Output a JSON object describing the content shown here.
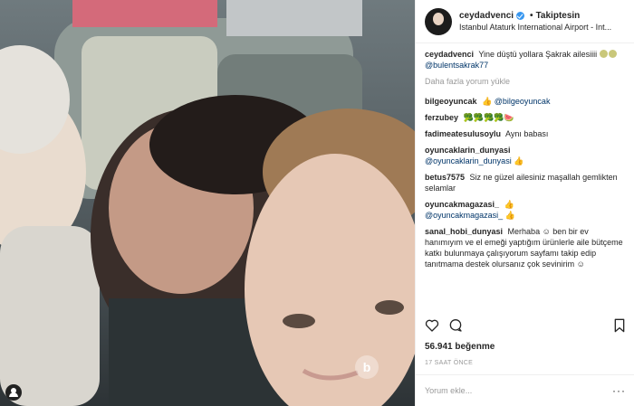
{
  "post": {
    "username": "ceydadvenci",
    "follow_label": "Takiptesin",
    "location": "Istanbul Ataturk International Airport - Int...",
    "caption_user": "ceydadvenci",
    "caption_text": "Yine düştü yollara Şakrak ailesiiii",
    "caption_mention": "@bulentsakrak77",
    "load_more": "Daha fazla yorum yükle"
  },
  "comments": [
    {
      "user": "bilgeoyuncak",
      "text": "👍",
      "mention": "@bilgeoyuncak"
    },
    {
      "user": "ferzubey",
      "text": "🥦🥦🥦🥦🍉",
      "mention": ""
    },
    {
      "user": "fadimeatesulusoylu",
      "text": "Aynı babası",
      "mention": ""
    },
    {
      "user": "oyuncaklarin_dunyasi",
      "text": "",
      "mention": "@oyuncaklarin_dunyasi 👍"
    },
    {
      "user": "betus7575",
      "text": "Siz ne güzel ailesiniz maşallah gemlikten selamlar",
      "mention": ""
    },
    {
      "user": "oyuncakmagazasi_",
      "text": "👍",
      "mention": "@oyuncakmagazasi_ 👍"
    },
    {
      "user": "sanal_hobi_dunyasi",
      "text": "Merhaba ☺ ben bir ev hanımıyım ve el emeği yaptığım ürünlerle aile bütçeme katkı bulunmaya çalışıyorum sayfamı takip edip tanıtmama destek olursanız çok sevinirim ☺",
      "mention": ""
    }
  ],
  "likes": "56.941 beğenme",
  "time": "17 SAAT ÖNCE",
  "add_comment_placeholder": "Yorum ekle...",
  "more_label": "···",
  "icons": {
    "heart": "heart-icon",
    "comment": "comment-icon",
    "bookmark": "bookmark-icon",
    "user_tag": "user-tag-icon",
    "verified": "verified-badge-icon"
  },
  "colors": {
    "mention": "#003569",
    "verified": "#3897f0",
    "muted": "#999999"
  }
}
